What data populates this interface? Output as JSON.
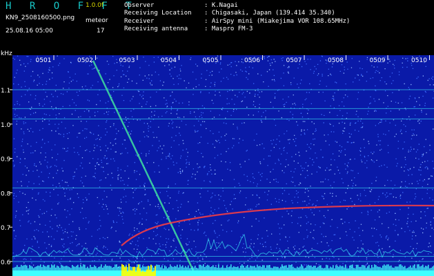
{
  "header": {
    "app_title": "H R O F F T",
    "version": "1.0.0f",
    "filename": "KN9_2508160500.png",
    "datetime": "25.08.16 05:00",
    "meteor_label": "meteor",
    "meteor_count": "17",
    "info": [
      {
        "key": "Observer",
        "value": ": K.Nagai"
      },
      {
        "key": "Receiving Location",
        "value": ": Chigasaki, Japan (139.414 35.340)"
      },
      {
        "key": "Receiver",
        "value": ": AirSpy mini (Miakejima VOR 108.65MHz)"
      },
      {
        "key": "Receiving antenna",
        "value": ": Maspro FM-3"
      }
    ]
  },
  "spectrogram": {
    "unit_label": "kHz",
    "time_labels": [
      "0501",
      "0502",
      "0503",
      "0504",
      "0505",
      "0506",
      "0507",
      "0508",
      "0509",
      "0510"
    ],
    "freq_ticks": [
      {
        "v": 1.1,
        "label": "1.1"
      },
      {
        "v": 1.0,
        "label": "1.0"
      },
      {
        "v": 0.9,
        "label": "0.9"
      },
      {
        "v": 0.8,
        "label": "0.8"
      },
      {
        "v": 0.7,
        "label": "0.7"
      },
      {
        "v": 0.6,
        "label": "0.6"
      }
    ],
    "colors": {
      "background": "#0a1aa8",
      "noise_light": "#3c6cff",
      "trace": "#40e0a0",
      "echo": "#ff4040",
      "baseline": "#40ffff",
      "burst": "#ffff00"
    }
  }
}
